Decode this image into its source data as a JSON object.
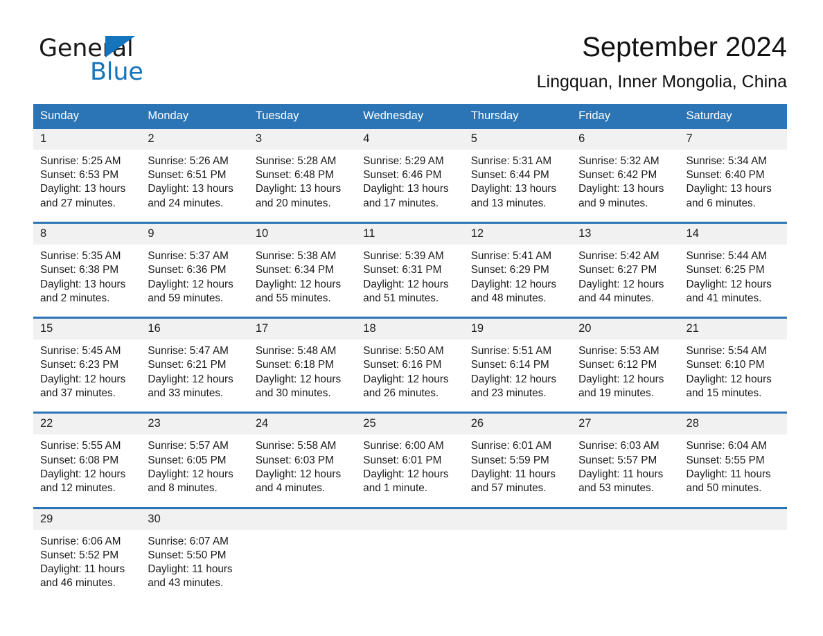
{
  "brand": {
    "word_general": "General",
    "word_blue": "Blue",
    "triangle_color": "#1474bc"
  },
  "header": {
    "title": "September 2024",
    "subtitle": "Lingquan, Inner Mongolia, China"
  },
  "theme": {
    "header_blue": "#2b74b5",
    "daynum_gray": "#f1f1f1",
    "text": "#1a1a1a"
  },
  "weekday_headers": [
    "Sunday",
    "Monday",
    "Tuesday",
    "Wednesday",
    "Thursday",
    "Friday",
    "Saturday"
  ],
  "weeks": [
    {
      "days": [
        {
          "num": "1",
          "sunrise": "Sunrise: 5:25 AM",
          "sunset": "Sunset: 6:53 PM",
          "daylight": "Daylight: 13 hours and 27 minutes."
        },
        {
          "num": "2",
          "sunrise": "Sunrise: 5:26 AM",
          "sunset": "Sunset: 6:51 PM",
          "daylight": "Daylight: 13 hours and 24 minutes."
        },
        {
          "num": "3",
          "sunrise": "Sunrise: 5:28 AM",
          "sunset": "Sunset: 6:48 PM",
          "daylight": "Daylight: 13 hours and 20 minutes."
        },
        {
          "num": "4",
          "sunrise": "Sunrise: 5:29 AM",
          "sunset": "Sunset: 6:46 PM",
          "daylight": "Daylight: 13 hours and 17 minutes."
        },
        {
          "num": "5",
          "sunrise": "Sunrise: 5:31 AM",
          "sunset": "Sunset: 6:44 PM",
          "daylight": "Daylight: 13 hours and 13 minutes."
        },
        {
          "num": "6",
          "sunrise": "Sunrise: 5:32 AM",
          "sunset": "Sunset: 6:42 PM",
          "daylight": "Daylight: 13 hours and 9 minutes."
        },
        {
          "num": "7",
          "sunrise": "Sunrise: 5:34 AM",
          "sunset": "Sunset: 6:40 PM",
          "daylight": "Daylight: 13 hours and 6 minutes."
        }
      ]
    },
    {
      "days": [
        {
          "num": "8",
          "sunrise": "Sunrise: 5:35 AM",
          "sunset": "Sunset: 6:38 PM",
          "daylight": "Daylight: 13 hours and 2 minutes."
        },
        {
          "num": "9",
          "sunrise": "Sunrise: 5:37 AM",
          "sunset": "Sunset: 6:36 PM",
          "daylight": "Daylight: 12 hours and 59 minutes."
        },
        {
          "num": "10",
          "sunrise": "Sunrise: 5:38 AM",
          "sunset": "Sunset: 6:34 PM",
          "daylight": "Daylight: 12 hours and 55 minutes."
        },
        {
          "num": "11",
          "sunrise": "Sunrise: 5:39 AM",
          "sunset": "Sunset: 6:31 PM",
          "daylight": "Daylight: 12 hours and 51 minutes."
        },
        {
          "num": "12",
          "sunrise": "Sunrise: 5:41 AM",
          "sunset": "Sunset: 6:29 PM",
          "daylight": "Daylight: 12 hours and 48 minutes."
        },
        {
          "num": "13",
          "sunrise": "Sunrise: 5:42 AM",
          "sunset": "Sunset: 6:27 PM",
          "daylight": "Daylight: 12 hours and 44 minutes."
        },
        {
          "num": "14",
          "sunrise": "Sunrise: 5:44 AM",
          "sunset": "Sunset: 6:25 PM",
          "daylight": "Daylight: 12 hours and 41 minutes."
        }
      ]
    },
    {
      "days": [
        {
          "num": "15",
          "sunrise": "Sunrise: 5:45 AM",
          "sunset": "Sunset: 6:23 PM",
          "daylight": "Daylight: 12 hours and 37 minutes."
        },
        {
          "num": "16",
          "sunrise": "Sunrise: 5:47 AM",
          "sunset": "Sunset: 6:21 PM",
          "daylight": "Daylight: 12 hours and 33 minutes."
        },
        {
          "num": "17",
          "sunrise": "Sunrise: 5:48 AM",
          "sunset": "Sunset: 6:18 PM",
          "daylight": "Daylight: 12 hours and 30 minutes."
        },
        {
          "num": "18",
          "sunrise": "Sunrise: 5:50 AM",
          "sunset": "Sunset: 6:16 PM",
          "daylight": "Daylight: 12 hours and 26 minutes."
        },
        {
          "num": "19",
          "sunrise": "Sunrise: 5:51 AM",
          "sunset": "Sunset: 6:14 PM",
          "daylight": "Daylight: 12 hours and 23 minutes."
        },
        {
          "num": "20",
          "sunrise": "Sunrise: 5:53 AM",
          "sunset": "Sunset: 6:12 PM",
          "daylight": "Daylight: 12 hours and 19 minutes."
        },
        {
          "num": "21",
          "sunrise": "Sunrise: 5:54 AM",
          "sunset": "Sunset: 6:10 PM",
          "daylight": "Daylight: 12 hours and 15 minutes."
        }
      ]
    },
    {
      "days": [
        {
          "num": "22",
          "sunrise": "Sunrise: 5:55 AM",
          "sunset": "Sunset: 6:08 PM",
          "daylight": "Daylight: 12 hours and 12 minutes."
        },
        {
          "num": "23",
          "sunrise": "Sunrise: 5:57 AM",
          "sunset": "Sunset: 6:05 PM",
          "daylight": "Daylight: 12 hours and 8 minutes."
        },
        {
          "num": "24",
          "sunrise": "Sunrise: 5:58 AM",
          "sunset": "Sunset: 6:03 PM",
          "daylight": "Daylight: 12 hours and 4 minutes."
        },
        {
          "num": "25",
          "sunrise": "Sunrise: 6:00 AM",
          "sunset": "Sunset: 6:01 PM",
          "daylight": "Daylight: 12 hours and 1 minute."
        },
        {
          "num": "26",
          "sunrise": "Sunrise: 6:01 AM",
          "sunset": "Sunset: 5:59 PM",
          "daylight": "Daylight: 11 hours and 57 minutes."
        },
        {
          "num": "27",
          "sunrise": "Sunrise: 6:03 AM",
          "sunset": "Sunset: 5:57 PM",
          "daylight": "Daylight: 11 hours and 53 minutes."
        },
        {
          "num": "28",
          "sunrise": "Sunrise: 6:04 AM",
          "sunset": "Sunset: 5:55 PM",
          "daylight": "Daylight: 11 hours and 50 minutes."
        }
      ]
    },
    {
      "days": [
        {
          "num": "29",
          "sunrise": "Sunrise: 6:06 AM",
          "sunset": "Sunset: 5:52 PM",
          "daylight": "Daylight: 11 hours and 46 minutes."
        },
        {
          "num": "30",
          "sunrise": "Sunrise: 6:07 AM",
          "sunset": "Sunset: 5:50 PM",
          "daylight": "Daylight: 11 hours and 43 minutes."
        },
        {
          "num": "",
          "sunrise": "",
          "sunset": "",
          "daylight": ""
        },
        {
          "num": "",
          "sunrise": "",
          "sunset": "",
          "daylight": ""
        },
        {
          "num": "",
          "sunrise": "",
          "sunset": "",
          "daylight": ""
        },
        {
          "num": "",
          "sunrise": "",
          "sunset": "",
          "daylight": ""
        },
        {
          "num": "",
          "sunrise": "",
          "sunset": "",
          "daylight": ""
        }
      ]
    }
  ]
}
